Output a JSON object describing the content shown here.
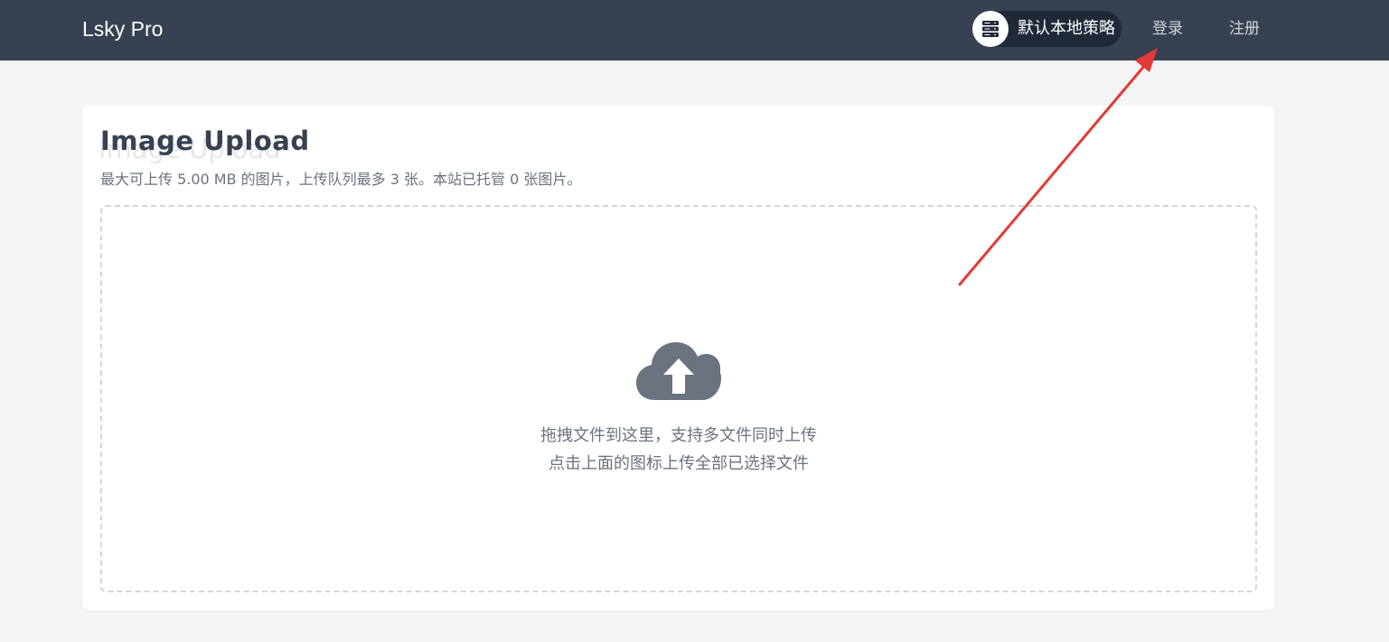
{
  "header": {
    "brand": "Lsky Pro",
    "strategy": {
      "icon": "server-icon",
      "label": "默认本地策略"
    },
    "nav": {
      "login": "登录",
      "register": "注册"
    }
  },
  "upload": {
    "title": "Image Upload",
    "subtitle": "最大可上传 5.00 MB 的图片，上传队列最多 3 张。本站已托管 0 张图片。",
    "dropzone": {
      "icon": "cloud-upload-icon",
      "hint_line1": "拖拽文件到这里，支持多文件同时上传",
      "hint_line2": "点击上面的图标上传全部已选择文件"
    }
  },
  "colors": {
    "header_bg": "#374151",
    "page_bg": "#f3f4f6",
    "card_bg": "#ffffff",
    "annotation_arrow": "#e53935",
    "icon_gray": "#6b7280"
  }
}
